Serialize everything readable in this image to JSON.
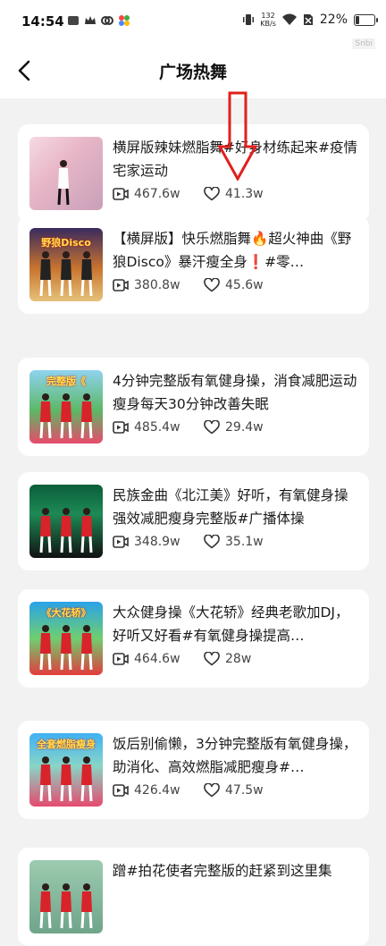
{
  "status": {
    "time": "14:54",
    "net_speed_value": "132",
    "net_speed_unit": "KB/s",
    "battery": "22%",
    "battery_level": 0.22
  },
  "header": {
    "title": "广场热舞",
    "watermark": "Snbi"
  },
  "videos": [
    {
      "title": "横屏版辣妹燃脂舞#好身材练起来#疫情宅家运动",
      "plays": "467.6w",
      "likes": "41.3w",
      "thumb_text": ""
    },
    {
      "title": "【横屏版】快乐燃脂舞🔥超火神曲《野狼Disco》暴汗瘦全身❗#零…",
      "plays": "380.8w",
      "likes": "45.6w",
      "thumb_text": "野狼Disco"
    },
    {
      "title": "4分钟完整版有氧健身操，消食减肥运动瘦身每天30分钟改善失眠",
      "plays": "485.4w",
      "likes": "29.4w",
      "thumb_text": "完整版《"
    },
    {
      "title": "民族金曲《北江美》好听，有氧健身操强效减肥瘦身完整版#广播体操",
      "plays": "348.9w",
      "likes": "35.1w",
      "thumb_text": ""
    },
    {
      "title": "大众健身操《大花轿》经典老歌加DJ，好听又好看#有氧健身操提高…",
      "plays": "464.6w",
      "likes": "28w",
      "thumb_text": "《大花轿》"
    },
    {
      "title": "饭后别偷懒，3分钟完整版有氧健身操，助消化、高效燃脂减肥瘦身#…",
      "plays": "426.4w",
      "likes": "47.5w",
      "thumb_text": "全套燃脂瘦身"
    },
    {
      "title": "蹭#拍花使者完整版的赶紧到这里集",
      "plays": "",
      "likes": "",
      "thumb_text": ""
    }
  ],
  "colors": {
    "accent_arrow": "#e0201e",
    "background": "#f2f2f2",
    "card": "#ffffff"
  }
}
